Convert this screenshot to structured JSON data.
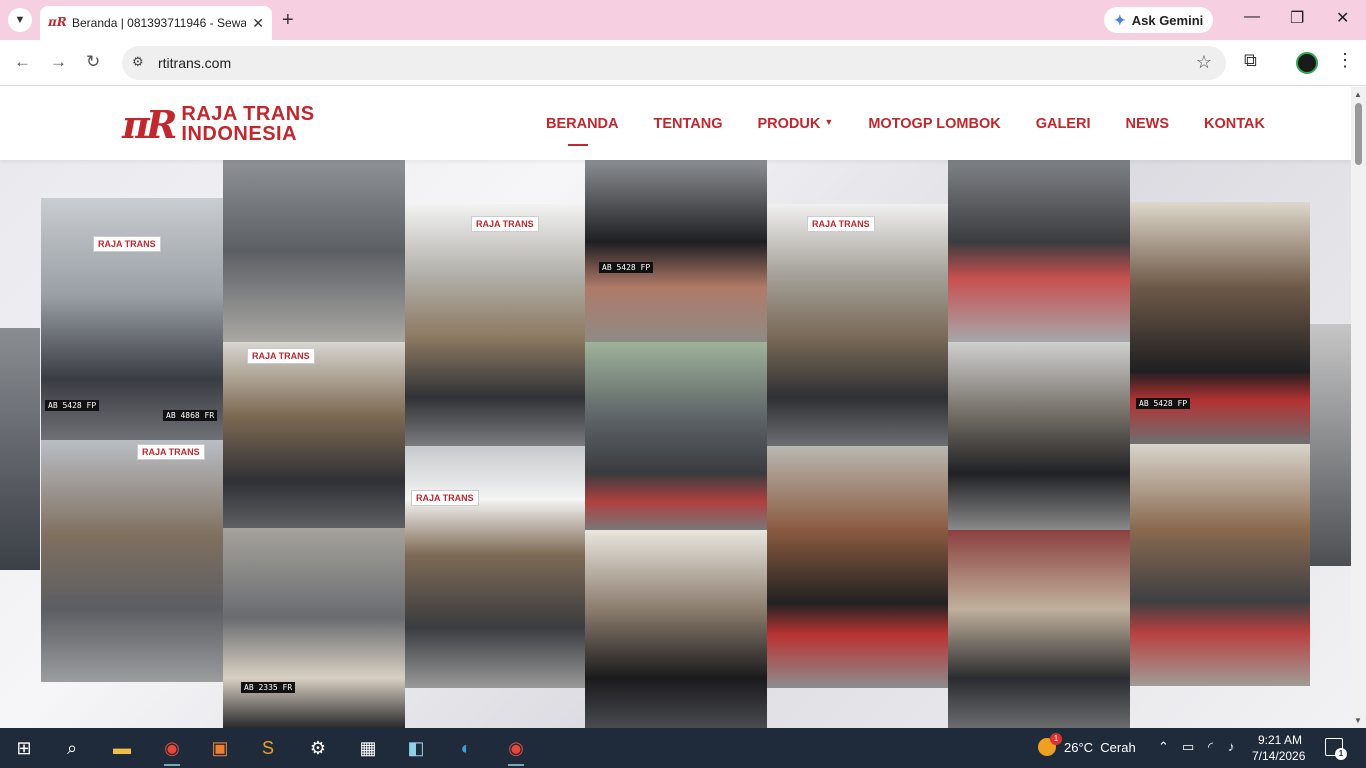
{
  "browser": {
    "tab_title": "Beranda | 081393711946 - Sewa",
    "gemini_label": "Ask Gemini",
    "url": "rtitrans.com"
  },
  "site": {
    "logo_mark": "πR",
    "logo_line1": "RAJA TRANS",
    "logo_line2": "INDONESIA",
    "brand_color": "#c1272d",
    "menu": [
      {
        "label": "BERANDA"
      },
      {
        "label": "TENTANG"
      },
      {
        "label": "PRODUK"
      },
      {
        "label": "MOTOGP LOMBOK"
      },
      {
        "label": "GALERI"
      },
      {
        "label": "NEWS"
      },
      {
        "label": "KONTAK"
      }
    ]
  },
  "collage": {
    "sign_text": "RAJA TRANS",
    "plates": [
      "AB 5428 FP",
      "AB 4868 FR",
      "AB 2335 FR",
      "AB 5428 FP",
      "AB 5428 FP"
    ]
  },
  "taskbar": {
    "weather_temp": "26°C",
    "weather_text": "Cerah",
    "weather_badge": "1",
    "time": "9:21 AM",
    "date": "7/14/2026",
    "notif_count": "1"
  }
}
